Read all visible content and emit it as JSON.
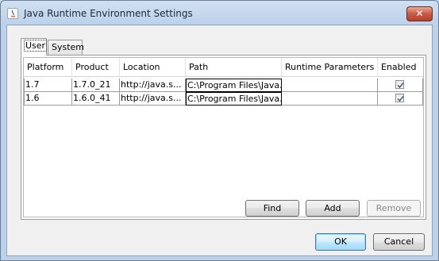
{
  "window": {
    "title": "Java Runtime Environment Settings",
    "close_label": "✕"
  },
  "tabs": [
    {
      "label": "User",
      "active": true
    },
    {
      "label": "System",
      "active": false
    }
  ],
  "table": {
    "columns": [
      "Platform",
      "Product",
      "Location",
      "Path",
      "Runtime Parameters",
      "Enabled"
    ],
    "rows": [
      {
        "platform": "1.7",
        "product": "1.7.0_21",
        "location": "http://java.s...",
        "path": "C:\\Program Files\\Java...",
        "runtime_parameters": "",
        "enabled": true
      },
      {
        "platform": "1.6",
        "product": "1.6.0_41",
        "location": "http://java.s...",
        "path": "C:\\Program Files\\Java...",
        "runtime_parameters": "",
        "enabled": true
      }
    ]
  },
  "buttons": {
    "find": "Find",
    "add": "Add",
    "remove": "Remove",
    "ok": "OK",
    "cancel": "Cancel"
  },
  "icons": {
    "app": "java-icon",
    "close": "close-icon",
    "check": "checkmark-icon"
  },
  "colors": {
    "title_bar": "#bcd1ea",
    "close_button": "#c75a44",
    "client_bg": "#f0f0f0"
  }
}
